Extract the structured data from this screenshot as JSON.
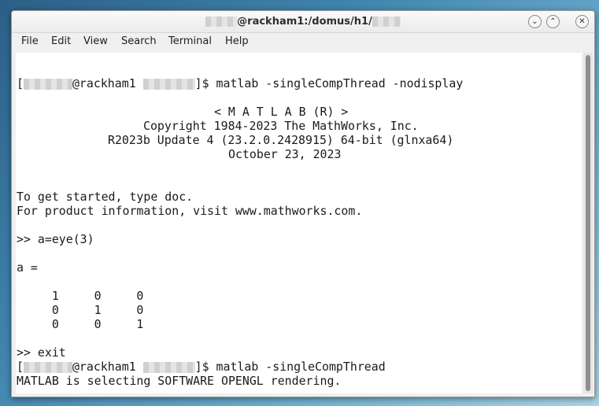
{
  "window": {
    "title": "@rackham1:/domus/h1/",
    "controls": {
      "minimize_icon": "chevron-down-icon",
      "maximize_icon": "chevron-up-icon",
      "close_icon": "close-icon"
    }
  },
  "menu": [
    "File",
    "Edit",
    "View",
    "Search",
    "Terminal",
    "Help"
  ],
  "terminal": {
    "prompt_host": "@rackham1",
    "cmd1": "]$ matlab -singleCompThread -nodisplay",
    "banner": [
      "< M A T L A B (R) >",
      "Copyright 1984-2023 The MathWorks, Inc.",
      "R2023b Update 4 (23.2.0.2428915) 64-bit (glnxa64)",
      "October 23, 2023"
    ],
    "info1": "To get started, type doc.",
    "info2": "For product information, visit www.mathworks.com.",
    "input1": ">> a=eye(3)",
    "result_label": "a =",
    "matrix_rows": [
      "     1     0     0",
      "     0     1     0",
      "     0     0     1"
    ],
    "input2": ">> exit",
    "cmd2": "]$ matlab -singleCompThread",
    "message": "MATLAB is selecting SOFTWARE OPENGL rendering."
  }
}
